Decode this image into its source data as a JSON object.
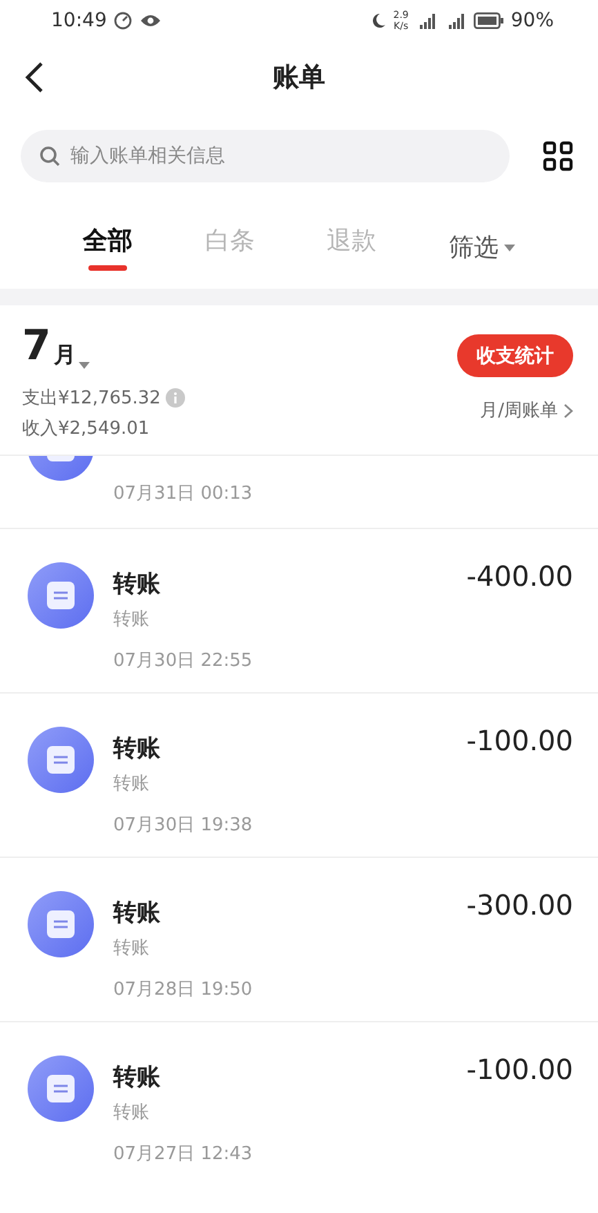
{
  "status_bar": {
    "time": "10:49",
    "net_speed": "2.9",
    "net_unit": "K/s",
    "battery": "90%"
  },
  "header": {
    "title": "账单"
  },
  "search": {
    "placeholder": "输入账单相关信息"
  },
  "tabs": [
    {
      "label": "全部",
      "selected": true,
      "kind": "tab"
    },
    {
      "label": "白条",
      "selected": false,
      "kind": "tab"
    },
    {
      "label": "退款",
      "selected": false,
      "kind": "tab"
    },
    {
      "label": "筛选",
      "selected": false,
      "kind": "dropdown"
    }
  ],
  "summary": {
    "month_number": "7",
    "month_unit": "月",
    "expense": "支出¥12,765.32",
    "income": "收入¥2,549.01",
    "stats_button": "收支统计",
    "period_link": "月/周账单"
  },
  "transactions": [
    {
      "kind": "partial",
      "date": "07月31日 00:13"
    },
    {
      "kind": "full",
      "title": "转账",
      "subtitle": "转账",
      "amount": "-400.00",
      "date": "07月30日 22:55"
    },
    {
      "kind": "full",
      "title": "转账",
      "subtitle": "转账",
      "amount": "-100.00",
      "date": "07月30日 19:38"
    },
    {
      "kind": "full",
      "title": "转账",
      "subtitle": "转账",
      "amount": "-300.00",
      "date": "07月28日 19:50"
    },
    {
      "kind": "full",
      "title": "转账",
      "subtitle": "转账",
      "amount": "-100.00",
      "date": "07月27日 12:43"
    }
  ]
}
